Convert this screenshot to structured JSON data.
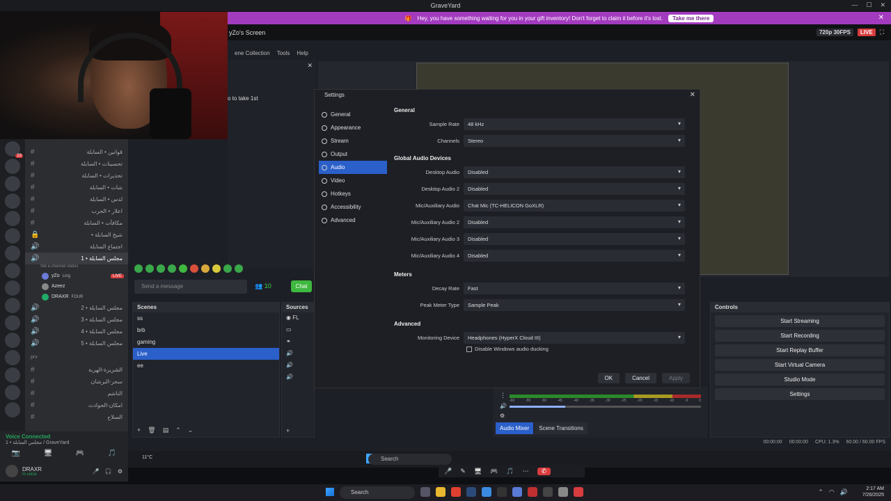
{
  "window": {
    "title": "GraveYard"
  },
  "banner": {
    "text": "Hey, you have something waiting for you in your gift inventory! Don't forget to claim it before it's lost.",
    "button": "Take me there"
  },
  "stream": {
    "title": "yZo's Screen",
    "quality": "720p 30FPS",
    "live": "LIVE"
  },
  "obs_menu": [
    "ene Collection",
    "Tools",
    "Help"
  ],
  "chat_panel": {
    "message": "o to take 1st",
    "send_placeholder": "Send a message",
    "viewers": "10",
    "chat_button": "Chat"
  },
  "discord": {
    "channels": [
      {
        "label": "قوانين • السابلة",
        "active": false
      },
      {
        "label": "تحسينات • السابلة",
        "active": false
      },
      {
        "label": "تحذيرات • السابلة",
        "active": false
      },
      {
        "label": "شات • السابلة",
        "active": false
      },
      {
        "label": "لدس • السابلة",
        "active": false
      },
      {
        "label": "اعلار • الحرب",
        "active": false
      },
      {
        "label": "مكافآت • السابلة",
        "active": false
      },
      {
        "label": "شيخ السابلة •",
        "active": false
      },
      {
        "label": "اجتماع السابلة",
        "active": false
      },
      {
        "label": "مجلس السابلة • 1",
        "active": true
      }
    ],
    "channel_status": "Set a channel status",
    "members": [
      {
        "name": "yZo",
        "tag": "Ling",
        "live": "LIVE"
      },
      {
        "name": "Azeez",
        "tag": "",
        "live": ""
      },
      {
        "name": "DRAXR",
        "tag": "FOUR",
        "live": ""
      }
    ],
    "voice_channels": [
      "مجلس السابلة • 2",
      "مجلس السابلة • 3",
      "مجلس السابلة • 4",
      "مجلس السابلة • 5"
    ],
    "category": "prv",
    "extra_channels": [
      "الشريرة-الهربة",
      "سحر-البرشان",
      "الناشم",
      "امكان-الحوادث",
      "السلاح"
    ],
    "voice_connected": "Voice Connected",
    "voice_location": "مجلس السابلة • 1 / GraveYard",
    "user": {
      "name": "DRAXR",
      "status": "In voice"
    }
  },
  "scenes": {
    "title": "Scenes",
    "items": [
      {
        "label": "ss",
        "sel": false
      },
      {
        "label": "brb",
        "sel": false
      },
      {
        "label": "gaming",
        "sel": false
      },
      {
        "label": "Live",
        "sel": true
      },
      {
        "label": "ee",
        "sel": false
      }
    ]
  },
  "sources": {
    "title": "Sources",
    "items": [
      "FL"
    ]
  },
  "controls": {
    "title": "Controls",
    "buttons": [
      "Start Streaming",
      "Start Recording",
      "Start Replay Buffer",
      "Start Virtual Camera",
      "Studio Mode",
      "Settings"
    ]
  },
  "mixer_tabs": [
    "Audio Mixer",
    "Scene Transitions"
  ],
  "mixer_ticks": [
    "-60",
    "-55",
    "-50",
    "-45",
    "-40",
    "-35",
    "-30",
    "-25",
    "-20",
    "-15",
    "-10",
    "-5",
    "0"
  ],
  "statusbar": {
    "time1": "00:00:00",
    "time2": "00:00:00",
    "cpu": "CPU: 1.3%",
    "fps": "60.00 / 60.00 FPS"
  },
  "settings": {
    "title": "Settings",
    "nav": [
      {
        "label": "General",
        "sel": false
      },
      {
        "label": "Appearance",
        "sel": false
      },
      {
        "label": "Stream",
        "sel": false
      },
      {
        "label": "Output",
        "sel": false
      },
      {
        "label": "Audio",
        "sel": true
      },
      {
        "label": "Video",
        "sel": false
      },
      {
        "label": "Hotkeys",
        "sel": false
      },
      {
        "label": "Accessibility",
        "sel": false
      },
      {
        "label": "Advanced",
        "sel": false
      }
    ],
    "general": {
      "title": "General",
      "rows": [
        {
          "label": "Sample Rate",
          "value": "48 kHz"
        },
        {
          "label": "Channels",
          "value": "Stereo"
        }
      ]
    },
    "devices": {
      "title": "Global Audio Devices",
      "rows": [
        {
          "label": "Desktop Audio",
          "value": "Disabled"
        },
        {
          "label": "Desktop Audio 2",
          "value": "Disabled"
        },
        {
          "label": "Mic/Auxiliary Audio",
          "value": "Chat Mic (TC-HELICON GoXLR)"
        },
        {
          "label": "Mic/Auxiliary Audio 2",
          "value": "Disabled"
        },
        {
          "label": "Mic/Auxiliary Audio 3",
          "value": "Disabled"
        },
        {
          "label": "Mic/Auxiliary Audio 4",
          "value": "Disabled"
        }
      ]
    },
    "meters": {
      "title": "Meters",
      "rows": [
        {
          "label": "Decay Rate",
          "value": "Fast"
        },
        {
          "label": "Peak Meter Type",
          "value": "Sample Peak"
        }
      ]
    },
    "advanced": {
      "title": "Advanced",
      "rows": [
        {
          "label": "Monitoring Device",
          "value": "Headphones (HyperX Cloud III)"
        }
      ],
      "checkbox": "Disable Windows audio ducking"
    },
    "buttons": {
      "ok": "OK",
      "cancel": "Cancel",
      "apply": "Apply"
    }
  },
  "inner_taskbar": {
    "search": "Search",
    "weather": "11°C"
  },
  "taskbar": {
    "search": "Search",
    "time": "2:17 AM",
    "date": "7/26/2025"
  },
  "colors": {
    "accent": "#2b5fc9",
    "banner": "#a33bbf",
    "live": "#d83c3e",
    "chat_green": "#3fb83f"
  }
}
